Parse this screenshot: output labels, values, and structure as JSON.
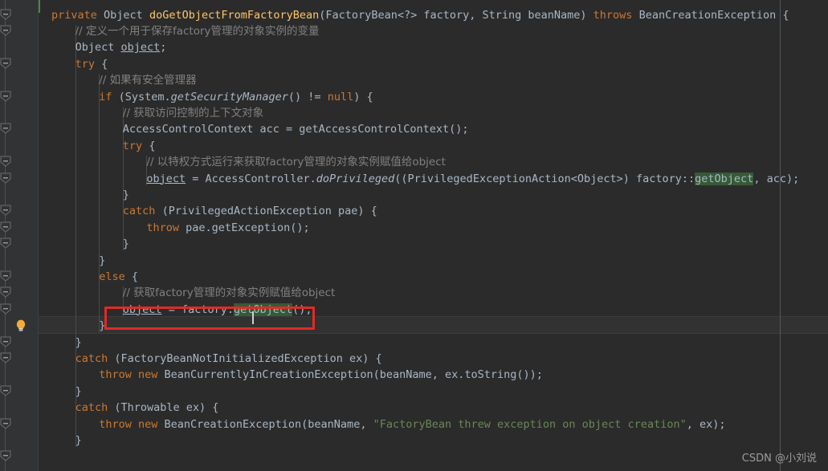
{
  "editor": {
    "theme_name": "darcula",
    "background": "#2b2b2b",
    "gutter_background": "#313335",
    "caret_line_background": "#323232",
    "default_text_color": "#a9b7c6",
    "keyword_color": "#cc7832",
    "comment_color": "#808080",
    "string_color": "#6a8759",
    "method_color": "#ffc66d",
    "usage_highlight_color": "#355a36",
    "annotation_box_color": "#e02b25",
    "change_marker_color": "#4a8a3f",
    "caret_line_index": 19
  },
  "gutter": {
    "fold_marker_name": "fold-collapse-marker",
    "fold_marker_rows": [
      0,
      1,
      3,
      5,
      7,
      9,
      10,
      12,
      13,
      14,
      16,
      17,
      18,
      20,
      21,
      23,
      25,
      27
    ],
    "intention_bulb": {
      "name": "intention-bulb-icon",
      "label": "Show intention actions",
      "row": 19,
      "color": "#f5ab35"
    }
  },
  "annotation": {
    "name": "red-highlight-box",
    "target_row": 19,
    "target_text": "object = factory.getObject();",
    "border_color": "#e02b25"
  },
  "watermark": {
    "text": "CSDN @小刘说"
  },
  "code": {
    "language": "java",
    "lines": [
      {
        "indent": 0,
        "tokens": [
          {
            "t": "private",
            "c": "kw"
          },
          {
            "t": " ",
            "c": "plain"
          },
          {
            "t": "Object",
            "c": "plain"
          },
          {
            "t": " ",
            "c": "plain"
          },
          {
            "t": "doGetObjectFromFactoryBean",
            "c": "meth"
          },
          {
            "t": "(FactoryBean<?> factory, String beanName) ",
            "c": "plain"
          },
          {
            "t": "throws",
            "c": "kw"
          },
          {
            "t": " BeanCreationException {",
            "c": "plain"
          }
        ]
      },
      {
        "indent": 1,
        "tokens": [
          {
            "t": "// 定义一个用于保存factory管理的对象实例的变量",
            "c": "cmt"
          }
        ]
      },
      {
        "indent": 1,
        "tokens": [
          {
            "t": "Object ",
            "c": "plain"
          },
          {
            "t": "object",
            "c": "plain und"
          },
          {
            "t": ";",
            "c": "plain"
          }
        ]
      },
      {
        "indent": 1,
        "tokens": [
          {
            "t": "try",
            "c": "kw"
          },
          {
            "t": " {",
            "c": "plain"
          }
        ]
      },
      {
        "indent": 2,
        "tokens": [
          {
            "t": "// 如果有安全管理器",
            "c": "cmt"
          }
        ]
      },
      {
        "indent": 2,
        "tokens": [
          {
            "t": "if",
            "c": "kw"
          },
          {
            "t": " (System.",
            "c": "plain"
          },
          {
            "t": "getSecurityManager",
            "c": "plain italic"
          },
          {
            "t": "() != ",
            "c": "plain"
          },
          {
            "t": "null",
            "c": "kw"
          },
          {
            "t": ") {",
            "c": "plain"
          }
        ]
      },
      {
        "indent": 3,
        "tokens": [
          {
            "t": "// 获取访问控制的上下文对象",
            "c": "cmt"
          }
        ]
      },
      {
        "indent": 3,
        "tokens": [
          {
            "t": "AccessControlContext acc = getAccessControlContext();",
            "c": "plain"
          }
        ]
      },
      {
        "indent": 3,
        "tokens": [
          {
            "t": "try",
            "c": "kw"
          },
          {
            "t": " {",
            "c": "plain"
          }
        ]
      },
      {
        "indent": 4,
        "tokens": [
          {
            "t": "// 以特权方式运行来获取factory管理的对象实例赋值给object",
            "c": "cmt"
          }
        ]
      },
      {
        "indent": 4,
        "tokens": [
          {
            "t": "object",
            "c": "plain und"
          },
          {
            "t": " = AccessController.",
            "c": "plain"
          },
          {
            "t": "doPrivileged",
            "c": "plain italic"
          },
          {
            "t": "((PrivilegedExceptionAction<Object>) factory::",
            "c": "plain"
          },
          {
            "t": "getObject",
            "c": "plain usage"
          },
          {
            "t": ", acc);",
            "c": "plain"
          }
        ]
      },
      {
        "indent": 3,
        "tokens": [
          {
            "t": "}",
            "c": "plain"
          }
        ]
      },
      {
        "indent": 3,
        "tokens": [
          {
            "t": "catch",
            "c": "kw"
          },
          {
            "t": " (PrivilegedActionException pae) {",
            "c": "plain"
          }
        ]
      },
      {
        "indent": 4,
        "tokens": [
          {
            "t": "throw",
            "c": "kw"
          },
          {
            "t": " pae.getException();",
            "c": "plain"
          }
        ]
      },
      {
        "indent": 3,
        "tokens": [
          {
            "t": "}",
            "c": "plain"
          }
        ]
      },
      {
        "indent": 2,
        "tokens": [
          {
            "t": "}",
            "c": "plain"
          }
        ]
      },
      {
        "indent": 2,
        "tokens": [
          {
            "t": "else",
            "c": "kw"
          },
          {
            "t": " {",
            "c": "plain"
          }
        ]
      },
      {
        "indent": 3,
        "tokens": [
          {
            "t": "// 获取factory管理的对象实例赋值给object",
            "c": "cmt"
          }
        ]
      },
      {
        "indent": 3,
        "tokens": [
          {
            "t": "object",
            "c": "plain und"
          },
          {
            "t": " = factory.",
            "c": "plain"
          },
          {
            "t": "getObject",
            "c": "plain usage"
          },
          {
            "t": "();",
            "c": "plain"
          }
        ]
      },
      {
        "indent": 2,
        "tokens": [
          {
            "t": "}",
            "c": "plain"
          }
        ]
      },
      {
        "indent": 1,
        "tokens": [
          {
            "t": "}",
            "c": "plain"
          }
        ]
      },
      {
        "indent": 1,
        "tokens": [
          {
            "t": "catch",
            "c": "kw"
          },
          {
            "t": " (FactoryBeanNotInitializedException ex) {",
            "c": "plain"
          }
        ]
      },
      {
        "indent": 2,
        "tokens": [
          {
            "t": "throw",
            "c": "kw"
          },
          {
            "t": " ",
            "c": "plain"
          },
          {
            "t": "new",
            "c": "kw"
          },
          {
            "t": " BeanCurrentlyInCreationException(beanName, ex.toString());",
            "c": "plain"
          }
        ]
      },
      {
        "indent": 1,
        "tokens": [
          {
            "t": "}",
            "c": "plain"
          }
        ]
      },
      {
        "indent": 1,
        "tokens": [
          {
            "t": "catch",
            "c": "kw"
          },
          {
            "t": " (Throwable ex) {",
            "c": "plain"
          }
        ]
      },
      {
        "indent": 2,
        "tokens": [
          {
            "t": "throw",
            "c": "kw"
          },
          {
            "t": " ",
            "c": "plain"
          },
          {
            "t": "new",
            "c": "kw"
          },
          {
            "t": " BeanCreationException(beanName, ",
            "c": "plain"
          },
          {
            "t": "\"FactoryBean threw exception on object creation\"",
            "c": "str"
          },
          {
            "t": ", ex);",
            "c": "plain"
          }
        ]
      },
      {
        "indent": 1,
        "tokens": [
          {
            "t": "}",
            "c": "plain"
          }
        ]
      }
    ]
  }
}
